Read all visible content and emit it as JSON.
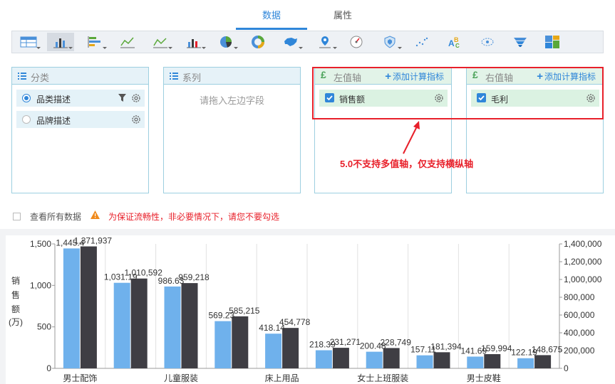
{
  "tabs": [
    {
      "label": "数据",
      "active": true
    },
    {
      "label": "属性",
      "active": false
    }
  ],
  "toolbar": {
    "icons": [
      "table-icon",
      "bar-chart-icon",
      "horizontal-bar-icon",
      "line-chart-icon",
      "area-chart-icon",
      "combo-chart-icon",
      "pie-chart-icon",
      "donut-chart-icon",
      "china-map-icon",
      "location-map-icon",
      "gauge-icon",
      "shield-icon",
      "scatter-icon",
      "word-cloud-icon",
      "bubble-icon",
      "funnel-icon",
      "treemap-icon"
    ],
    "selected": "bar-chart-icon"
  },
  "panels": {
    "category": {
      "title": "分类",
      "fields": [
        {
          "label": "品类描述",
          "selected": true
        },
        {
          "label": "品牌描述",
          "selected": false
        }
      ]
    },
    "series": {
      "title": "系列",
      "placeholder": "请拖入左边字段"
    },
    "left_axis": {
      "title": "左值轴",
      "add_label": "添加计算指标",
      "fields": [
        {
          "label": "销售额",
          "checked": true
        }
      ]
    },
    "right_axis": {
      "title": "右值轴",
      "add_label": "添加计算指标",
      "fields": [
        {
          "label": "毛利",
          "checked": true
        }
      ]
    }
  },
  "annotation": "5.0不支持多值轴，仅支持横纵轴",
  "show_all": {
    "label": "查看所有数据",
    "warning": "为保证流畅性，非必要情况下，请您不要勾选"
  },
  "colors": {
    "accent": "#2f86d9",
    "warning": "#e8202a",
    "series1": "#6fb1ec",
    "series2": "#3f3e44"
  },
  "chart_data": {
    "type": "bar",
    "ylabel_chars": [
      "销",
      "售",
      "额",
      "(万)"
    ],
    "ylim": [
      0,
      1500
    ],
    "y2lim": [
      0,
      1400000
    ],
    "yticks": [
      "1,500",
      "1,000",
      "500",
      "0"
    ],
    "y2ticks": [
      "1,400,000",
      "1,200,000",
      "1,000,000",
      "800,000",
      "600,000",
      "400,000",
      "200,000",
      "0"
    ],
    "categories": [
      "男士配饰",
      "",
      "儿童服装",
      "",
      "床上用品",
      "",
      "女士上班服装",
      "",
      "男士皮鞋",
      ""
    ],
    "series": [
      {
        "values": [
          1445.4,
          1031.19,
          986.63,
          569.23,
          418.14,
          218.39,
          200.48,
          157.11,
          141.69,
          122.19
        ],
        "labels": [
          "1,445.4",
          "1,031.19",
          "986.63",
          "569.23",
          "418.14",
          "218.39",
          "200.48",
          "157.11",
          "141.69",
          "122.19"
        ]
      },
      {
        "values": [
          1371937,
          1010592,
          959218,
          585215,
          454778,
          231271,
          228749,
          181394,
          159994,
          148675
        ],
        "labels": [
          "1,371,937",
          "1,010,592",
          "959,218",
          "585,215",
          "454,778",
          "231,271",
          "228,749",
          "181,394",
          "159,994",
          "148,675"
        ]
      }
    ]
  }
}
